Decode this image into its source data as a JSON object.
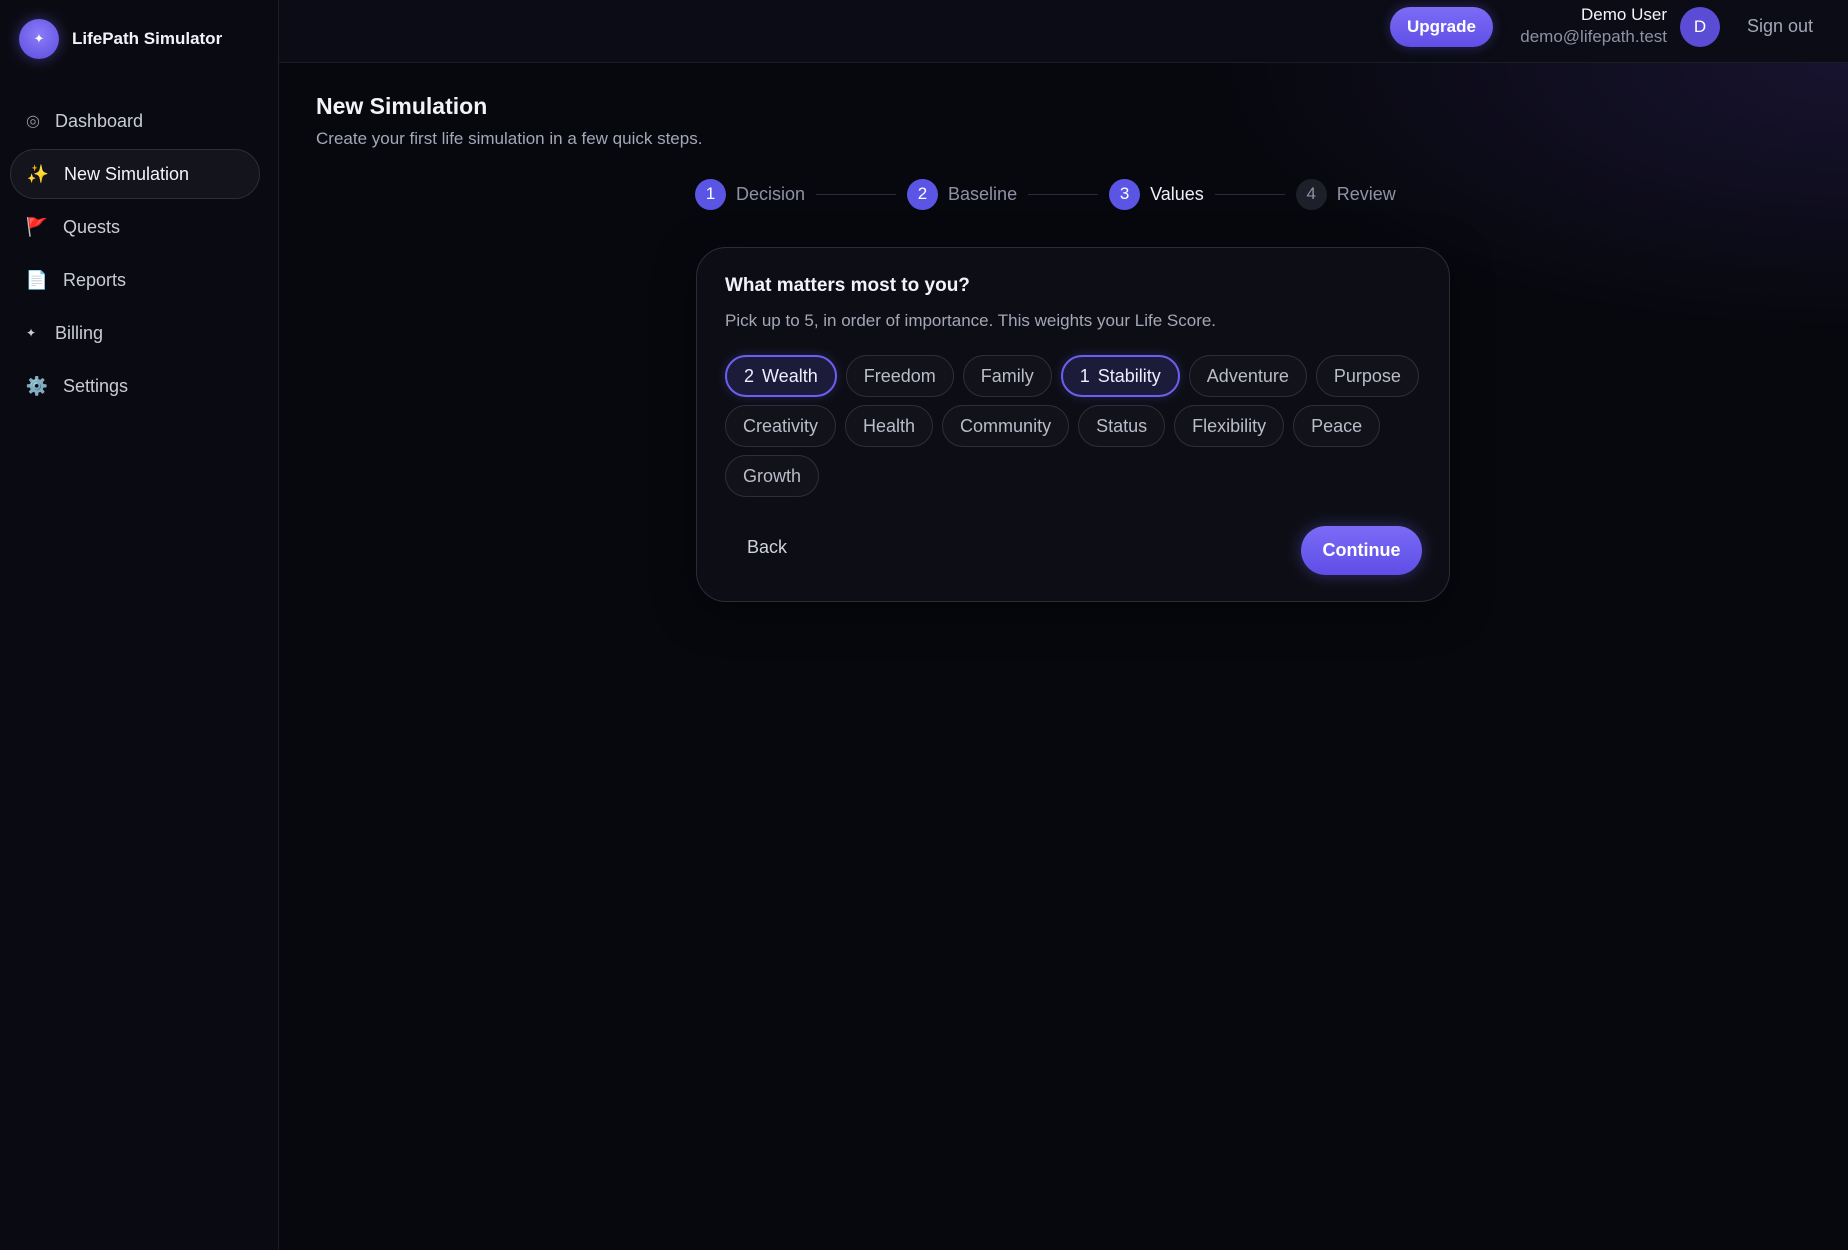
{
  "brand": {
    "logo_icon": "✦",
    "name": "LifePath Simulator"
  },
  "sidebar": {
    "items": [
      {
        "icon": "◎",
        "icon_name": "dashboard-icon",
        "label": "Dashboard"
      },
      {
        "icon": "✨",
        "icon_name": "sparkles-icon",
        "label": "New Simulation",
        "active": true
      },
      {
        "icon": "🚩",
        "icon_name": "flag-icon",
        "label": "Quests"
      },
      {
        "icon": "📄",
        "icon_name": "document-icon",
        "label": "Reports"
      },
      {
        "icon": "✦",
        "icon_name": "sparkle-icon",
        "label": "Billing"
      },
      {
        "icon": "⚙️",
        "icon_name": "gear-icon",
        "label": "Settings"
      }
    ]
  },
  "topbar": {
    "upgrade_label": "Upgrade",
    "user_name": "Demo User",
    "user_email": "demo@lifepath.test",
    "avatar_initial": "D",
    "signout_label": "Sign out"
  },
  "page": {
    "title": "New Simulation",
    "subtitle": "Create your first life simulation in a few quick steps."
  },
  "stepper": {
    "steps": [
      {
        "num": "1",
        "label": "Decision",
        "state": "completed"
      },
      {
        "num": "2",
        "label": "Baseline",
        "state": "completed"
      },
      {
        "num": "3",
        "label": "Values",
        "state": "current"
      },
      {
        "num": "4",
        "label": "Review",
        "state": "upcoming"
      }
    ]
  },
  "card": {
    "title": "What matters most to you?",
    "subtitle": "Pick up to 5, in order of importance. This weights your Life Score.",
    "values": [
      {
        "rank": "2",
        "label": "Wealth",
        "selected": true
      },
      {
        "rank": "",
        "label": "Freedom",
        "selected": false
      },
      {
        "rank": "",
        "label": "Family",
        "selected": false
      },
      {
        "rank": "1",
        "label": "Stability",
        "selected": true
      },
      {
        "rank": "",
        "label": "Adventure",
        "selected": false
      },
      {
        "rank": "",
        "label": "Purpose",
        "selected": false
      },
      {
        "rank": "",
        "label": "Creativity",
        "selected": false
      },
      {
        "rank": "",
        "label": "Health",
        "selected": false
      },
      {
        "rank": "",
        "label": "Community",
        "selected": false
      },
      {
        "rank": "",
        "label": "Status",
        "selected": false
      },
      {
        "rank": "",
        "label": "Flexibility",
        "selected": false
      },
      {
        "rank": "",
        "label": "Peace",
        "selected": false
      },
      {
        "rank": "",
        "label": "Growth",
        "selected": false
      }
    ],
    "back_label": "Back",
    "continue_label": "Continue"
  },
  "colors": {
    "accent": "#6c5ff0",
    "background": "#07080e"
  }
}
